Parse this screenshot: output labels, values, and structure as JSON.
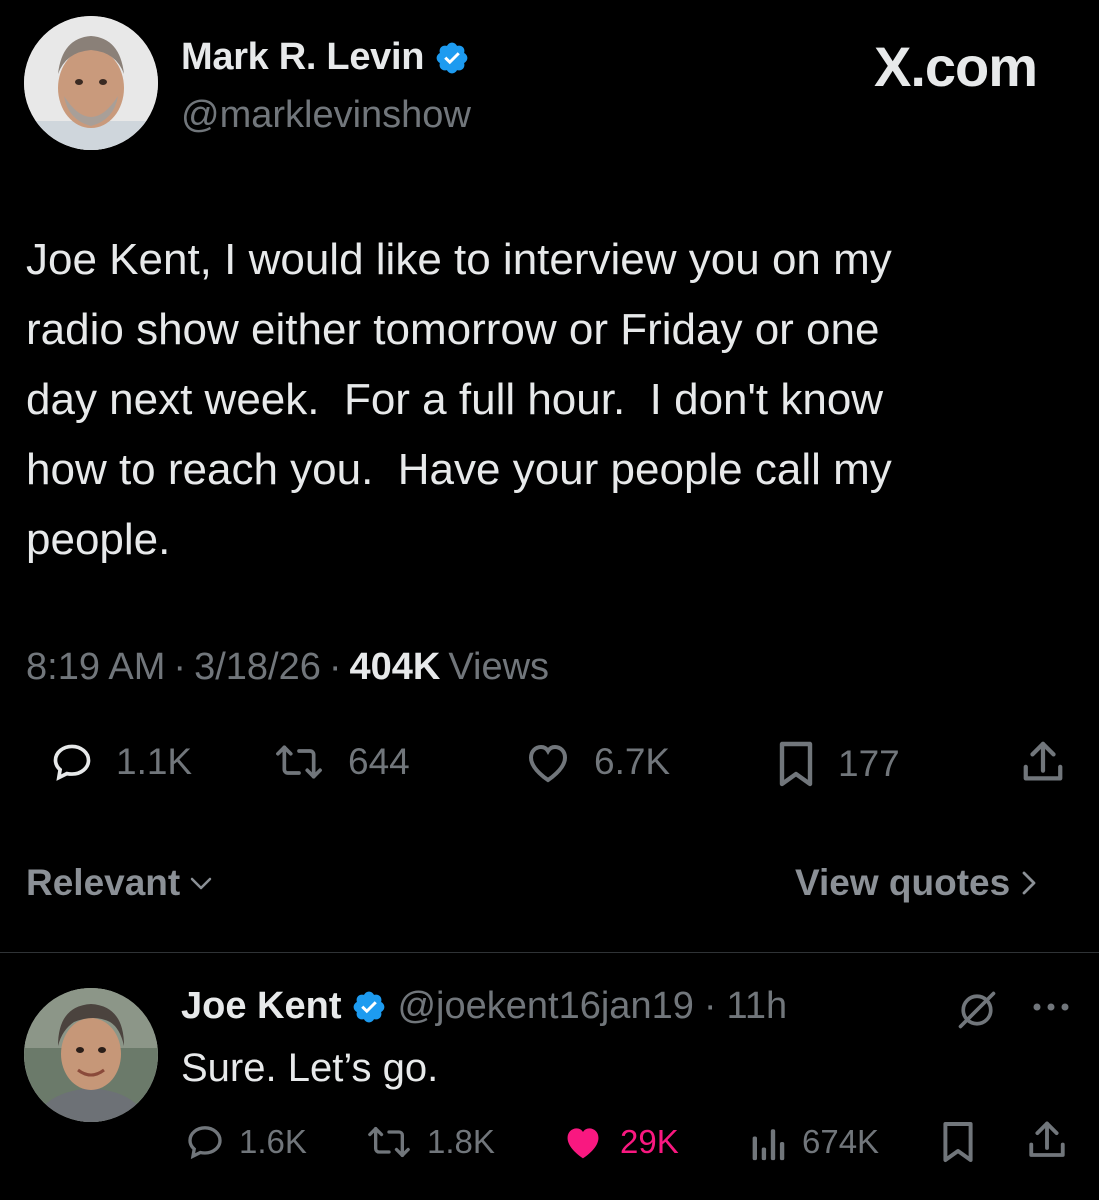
{
  "tweet": {
    "author": {
      "name": "Mark R. Levin",
      "handle": "@marklevinshow"
    },
    "brand": "X.com",
    "text": "Joe Kent, I would like to interview you on my\nradio show either tomorrow or Friday or one\nday next week.  For a full hour.  I don't know\nhow to reach you.  Have your people call my\npeople.",
    "time": "8:19 AM",
    "date": "3/18/26",
    "views_count": "404K",
    "views_label": "Views",
    "separator": "·",
    "actions": {
      "replies": "1.1K",
      "reposts": "644",
      "likes": "6.7K",
      "bookmarks": "177"
    }
  },
  "sort_bar": {
    "sort_label": "Relevant",
    "view_quotes_label": "View quotes"
  },
  "reply": {
    "author": {
      "name": "Joe Kent",
      "handle": "@joekent16jan19"
    },
    "time": "11h",
    "separator": "·",
    "text": "Sure. Let’s go.",
    "actions": {
      "replies": "1.6K",
      "reposts": "1.8K",
      "likes": "29K",
      "views": "674K"
    },
    "liked": true
  },
  "colors": {
    "background": "#000000",
    "text": "#e7e9ea",
    "muted": "#71767b",
    "verified": "#1d9bf0",
    "like": "#f91880"
  },
  "icons": [
    "verified-badge-icon",
    "reply-icon",
    "repost-icon",
    "like-icon",
    "bookmark-icon",
    "share-icon",
    "chevron-down-icon",
    "chevron-right-icon",
    "grok-icon",
    "more-icon",
    "views-icon"
  ]
}
